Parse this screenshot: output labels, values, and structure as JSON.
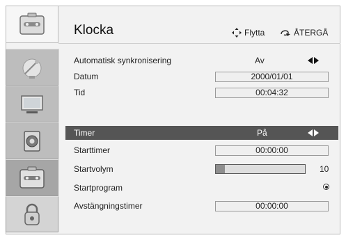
{
  "header": {
    "title": "Klocka",
    "hint_move": "Flytta",
    "hint_back": "ÅTERGÅ"
  },
  "sidebar": {
    "icons": [
      "settings-icon",
      "satellite-dish-icon",
      "monitor-icon",
      "speaker-icon",
      "settings-icon",
      "lock-icon"
    ],
    "active_index": 4
  },
  "rows": {
    "auto_sync": {
      "label": "Automatisk synkronisering",
      "value": "Av"
    },
    "date": {
      "label": "Datum",
      "value": "2000/01/01"
    },
    "time": {
      "label": "Tid",
      "value": "00:04:32"
    },
    "timer": {
      "label": "Timer",
      "value": "På"
    },
    "start_timer": {
      "label": "Starttimer",
      "value": "00:00:00"
    },
    "start_volume": {
      "label": "Startvolym",
      "value": "10",
      "level_fraction": 0.1
    },
    "start_program": {
      "label": "Startprogram"
    },
    "off_timer": {
      "label": "Avstängningstimer",
      "value": "00:00:00"
    }
  },
  "colors": {
    "selected_row": "#555555",
    "panel_bg": "#f2f2f2",
    "sidebar_bg": "#bdbdbd"
  }
}
